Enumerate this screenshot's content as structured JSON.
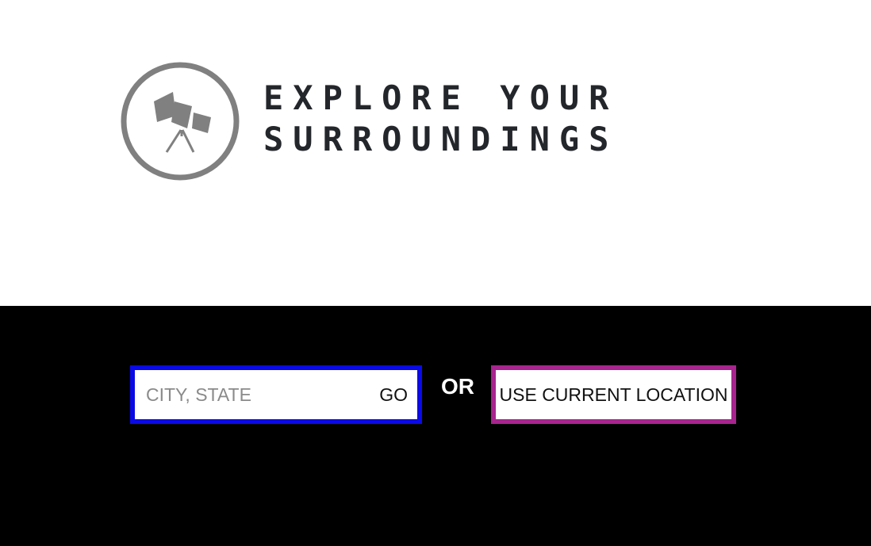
{
  "logo": {
    "icon": "telescope-icon",
    "title_line1": "EXPLORE YOUR",
    "title_line2": "SURROUNDINGS",
    "icon_color": "#808080",
    "text_color": "#23262b"
  },
  "search": {
    "placeholder": "CITY, STATE",
    "value": "",
    "go_label": "GO",
    "border_color": "#0a0ae6"
  },
  "separator": {
    "or_label": "OR"
  },
  "location": {
    "button_label": "USE CURRENT LOCATION",
    "border_color": "#a8248e"
  },
  "colors": {
    "header_bg": "#ffffff",
    "band_bg": "#000000"
  }
}
